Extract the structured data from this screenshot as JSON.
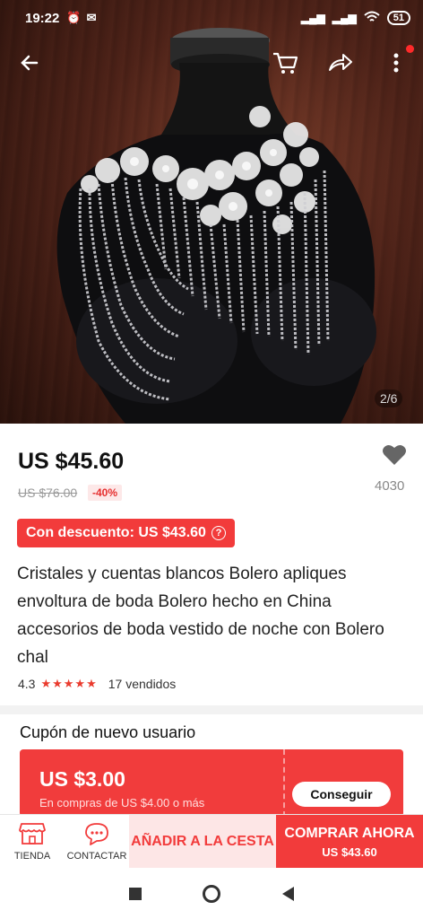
{
  "status_bar": {
    "time": "19:22",
    "battery": "51"
  },
  "header": {
    "image_counter": "2/6"
  },
  "product": {
    "price": "US $45.60",
    "original_price": "US $76.00",
    "discount_percent": "-40%",
    "wishlist_count": "4030",
    "promo_label": "Con descuento: US $43.60",
    "title": "Cristales y cuentas blancos Bolero apliques envoltura de boda Bolero hecho en China accesorios de boda vestido de noche con Bolero chal",
    "rating": "4.3",
    "rating_stars": 4.3,
    "stars_display": "★★★★★",
    "sold": "17 vendidos"
  },
  "coupon": {
    "heading": "Cupón de nuevo usuario",
    "amount": "US $3.00",
    "condition": "En compras de US $4.00 o más",
    "button": "Conseguir"
  },
  "actions": {
    "store": "TIENDA",
    "contact": "CONTACTAR",
    "add_to_cart": "AÑADIR A LA CESTA",
    "buy_now": "COMPRAR AHORA",
    "buy_now_price": "US $43.60"
  },
  "colors": {
    "accent": "#f23b3b",
    "accent_light": "#fde6e6"
  }
}
